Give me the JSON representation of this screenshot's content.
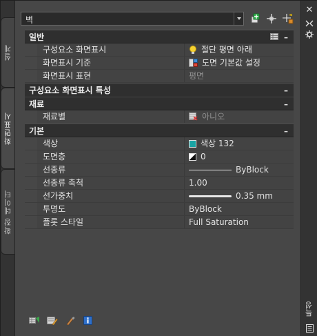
{
  "left_tabs": [
    {
      "label": "설계",
      "active": false
    },
    {
      "label": "화면표시",
      "active": true
    },
    {
      "label": "확장 데이터",
      "active": false
    }
  ],
  "toolbar": {
    "object_type": "벽"
  },
  "categories": {
    "general": {
      "title": "일반",
      "rows": [
        {
          "name": "구성요소 화면표시",
          "value": "절단 평면 아래"
        },
        {
          "name": "화면표시 기준",
          "value": "도면 기본값 설정"
        },
        {
          "name": "화면표시 표현",
          "value": "평면"
        }
      ]
    },
    "component_props": {
      "title": "구성요소 화면표시 특성"
    },
    "material": {
      "title": "재료",
      "rows": [
        {
          "name": "재료별",
          "value": "아니오"
        }
      ]
    },
    "basic": {
      "title": "기본",
      "rows": [
        {
          "name": "색상",
          "value": "색상 132"
        },
        {
          "name": "도면층",
          "value": "0"
        },
        {
          "name": "선종류",
          "value": "ByBlock"
        },
        {
          "name": "선종류 축척",
          "value": "1.00"
        },
        {
          "name": "선가중치",
          "value": "0.35 mm"
        },
        {
          "name": "투명도",
          "value": "ByBlock"
        },
        {
          "name": "플롯 스타일",
          "value": "Full Saturation"
        }
      ]
    }
  },
  "collapse_symbol": "–",
  "palette_title": "특성",
  "colors": {
    "swatch_color_132": "#1aa3a3"
  }
}
